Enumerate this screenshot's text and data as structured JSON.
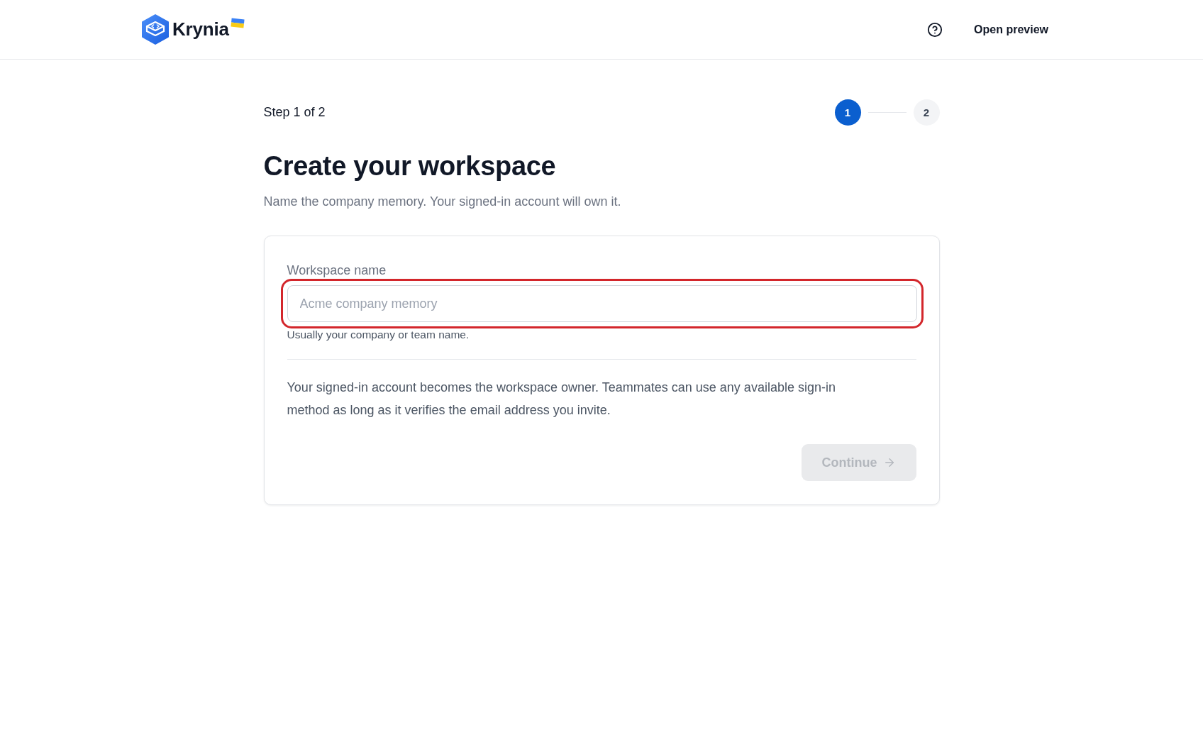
{
  "header": {
    "brand": "Krynia",
    "preview_link": "Open preview"
  },
  "stepper": {
    "label": "Step 1 of 2",
    "steps": [
      {
        "label": "1",
        "selected": true
      },
      {
        "label": "2",
        "selected": false
      }
    ]
  },
  "title": "Create your workspace",
  "subtitle": "Name the company memory. Your signed-in account will own it.",
  "form": {
    "field": {
      "label": "Workspace name",
      "placeholder": "Acme company memory",
      "highlighted": true,
      "hint": "Usually your company or team name."
    },
    "note": "Your signed-in account becomes the workspace owner. Teammates can use any available sign-in method as long as it verifies the email address you invite.",
    "submit": {
      "label": "Continue",
      "disabled": true
    }
  }
}
